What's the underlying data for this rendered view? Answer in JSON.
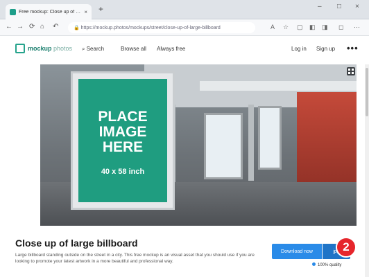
{
  "browser": {
    "tab_title": "Free mockup: Close up of lar…",
    "tab_close": "×",
    "new_tab": "+",
    "minimize": "–",
    "restore": "□",
    "close": "×",
    "url": "https://mockup.photos/mockups/street/close-up-of-large-billboard"
  },
  "site": {
    "logo_main": "mockup",
    "logo_sub": "photos",
    "menu": [
      "Search",
      "Browse all",
      "Always free"
    ],
    "login": "Log in",
    "signup": "Sign up",
    "more": "•••"
  },
  "hero": {
    "placeholder_lines": [
      "PLACE",
      "IMAGE",
      "HERE"
    ],
    "size_label": "40 x 58 inch",
    "colors": {
      "billboard": "#1f9d80"
    }
  },
  "content": {
    "title": "Close up of large billboard",
    "description": "Large billboard standing outside on the street in a city. This free mockup is an visual asset that you should use if you are looking to promote your latest artwork in a more beautiful and professional way.",
    "download_label": "Download now",
    "format_label": "jpg",
    "quality_label": "100% quality",
    "step_number": "2"
  },
  "colors": {
    "accent": "#2a8be8",
    "brand": "#25a38c",
    "badge": "#e6262c"
  }
}
